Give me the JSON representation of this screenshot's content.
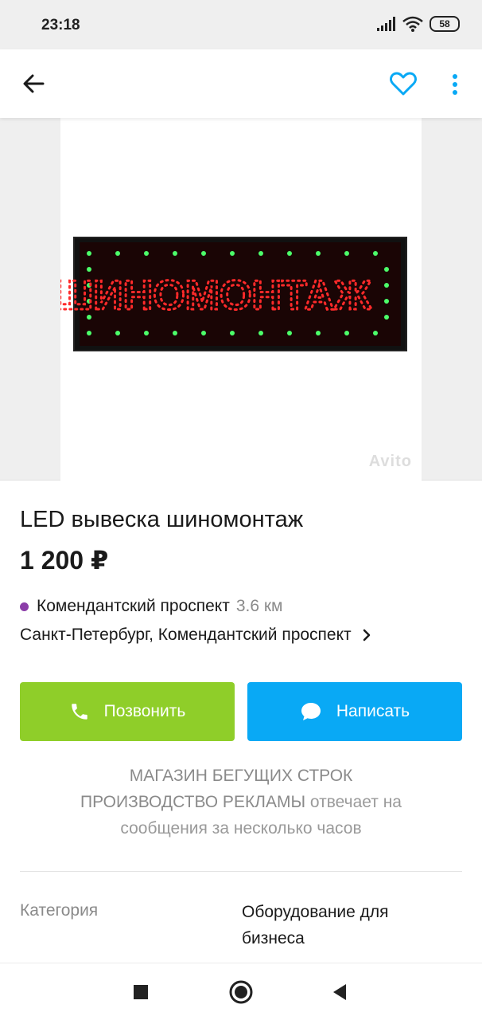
{
  "status_bar": {
    "time": "23:18",
    "battery": "58"
  },
  "app_bar": {
    "back_icon": "arrow-left-icon",
    "favorite_icon": "heart-outline-icon",
    "more_icon": "more-vertical-icon",
    "accent_color": "#09a9f5"
  },
  "photo": {
    "sign_text": "ШИНОМОНТАЖ",
    "watermark": "Avito"
  },
  "listing": {
    "title": "LED вывеска шиномонтаж",
    "price": "1 200 ₽",
    "metro_station": "Комендантский проспект",
    "metro_distance": "3.6 км",
    "metro_color": "#8b3da8",
    "address": "Санкт-Петербург, Комендантский проспект"
  },
  "actions": {
    "call_label": "Позвонить",
    "call_color": "#8fce29",
    "write_label": "Написать",
    "write_color": "#09a9f5"
  },
  "seller": {
    "name_line1": "МАГАЗИН БЕГУЩИХ СТРОК",
    "name_line2": "ПРОИЗВОДСТВО РЕКЛАМЫ",
    "reply_line1": "отвечает на",
    "reply_line2": "сообщения за несколько часов"
  },
  "params": [
    {
      "label": "Категория",
      "value_line1": "Оборудование для",
      "value_line2": "бизнеса"
    }
  ],
  "nav_bar": {
    "recents_icon": "square-icon",
    "home_icon": "circle-icon",
    "back_icon": "triangle-back-icon"
  }
}
